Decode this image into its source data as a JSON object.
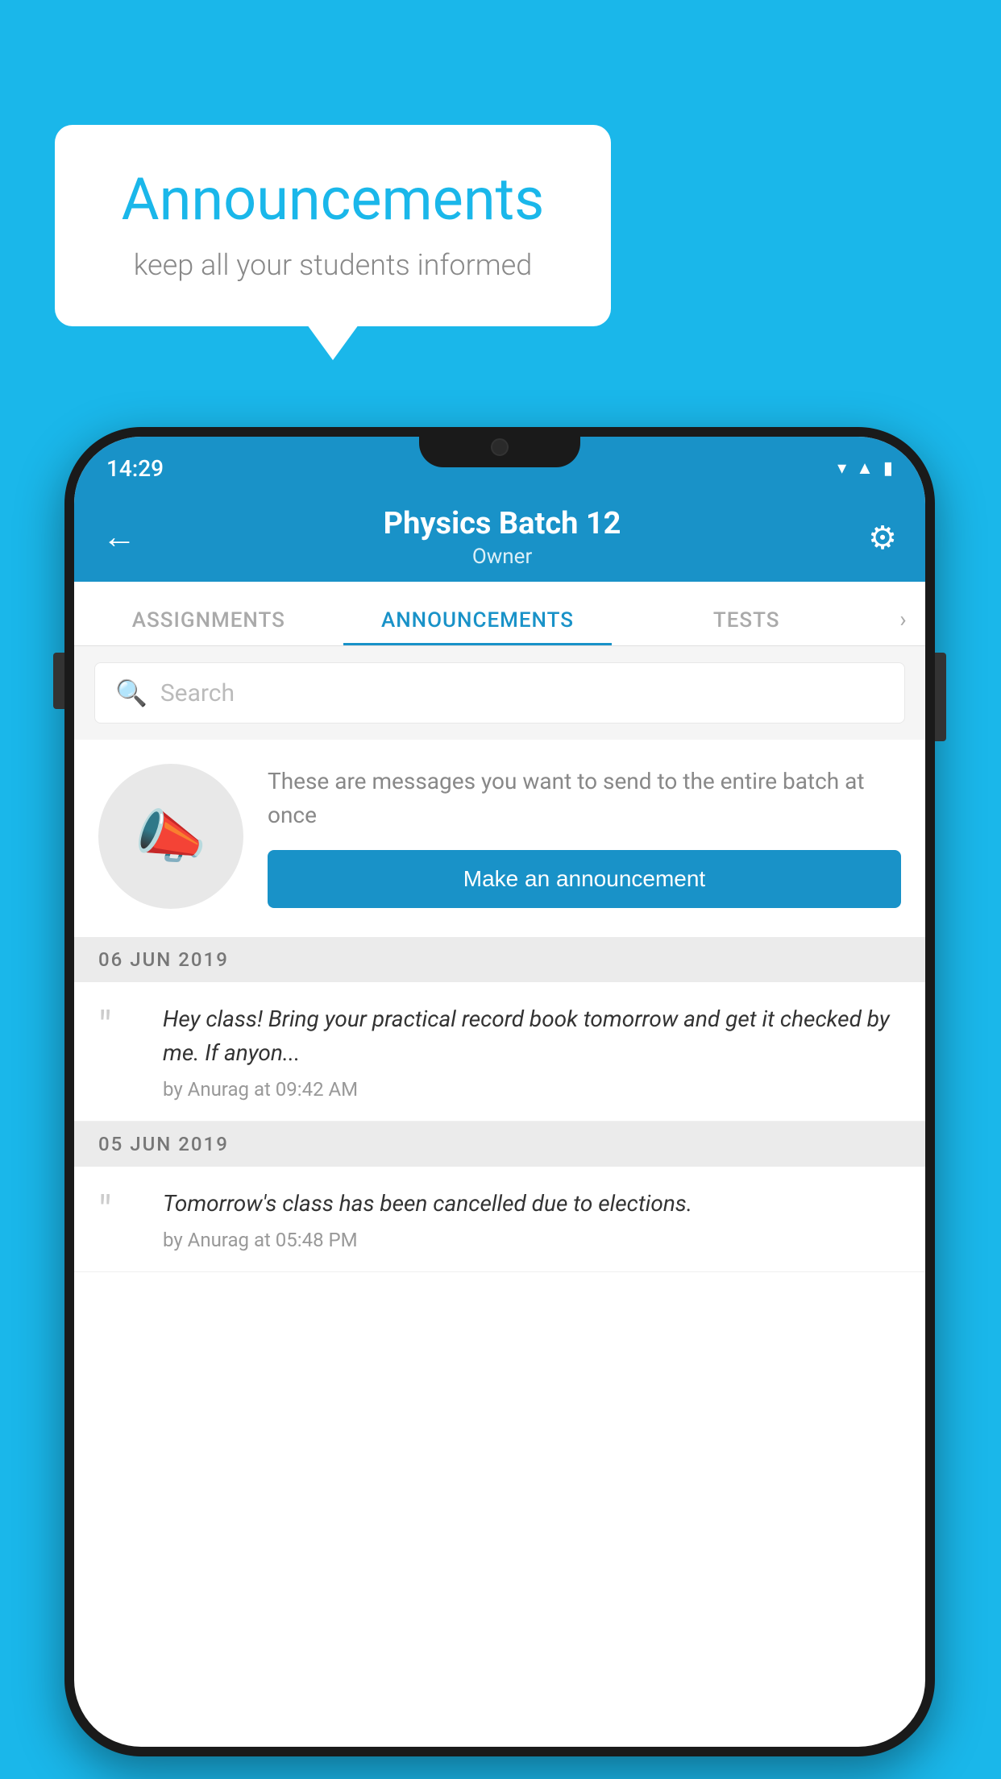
{
  "background_color": "#1AB7EA",
  "speech_bubble": {
    "title": "Announcements",
    "subtitle": "keep all your students informed"
  },
  "phone": {
    "status_bar": {
      "time": "14:29",
      "icons": [
        "wifi",
        "signal",
        "battery"
      ]
    },
    "header": {
      "title": "Physics Batch 12",
      "subtitle": "Owner",
      "back_label": "←",
      "gear_label": "⚙"
    },
    "tabs": [
      {
        "label": "ASSIGNMENTS",
        "active": false
      },
      {
        "label": "ANNOUNCEMENTS",
        "active": true
      },
      {
        "label": "TESTS",
        "active": false
      }
    ],
    "search": {
      "placeholder": "Search"
    },
    "promo": {
      "description": "These are messages you want to send to the entire batch at once",
      "button_label": "Make an announcement"
    },
    "announcements": [
      {
        "date": "06  JUN  2019",
        "items": [
          {
            "message": "Hey class! Bring your practical record book tomorrow and get it checked by me. If anyon...",
            "author": "by Anurag at 09:42 AM"
          }
        ]
      },
      {
        "date": "05  JUN  2019",
        "items": [
          {
            "message": "Tomorrow's class has been cancelled due to elections.",
            "author": "by Anurag at 05:48 PM"
          }
        ]
      }
    ]
  }
}
